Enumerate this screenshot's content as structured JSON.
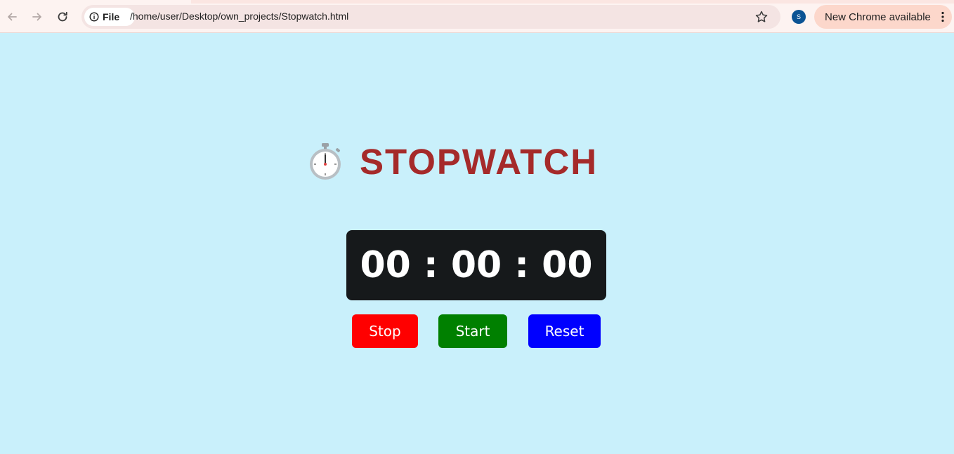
{
  "browser": {
    "address_chip_label": "File",
    "url": "/home/user/Desktop/own_projects/Stopwatch.html",
    "profile_initial": "S",
    "update_label": "New Chrome available"
  },
  "page": {
    "title": "STOPWATCH",
    "time_display": "00 : 00 : 00",
    "buttons": {
      "stop": "Stop",
      "start": "Start",
      "reset": "Reset"
    }
  },
  "colors": {
    "page_background": "#c9f0fb",
    "title": "#a52a2a",
    "display_background": "#16191b",
    "stop_button": "#ff0000",
    "start_button": "#008000",
    "reset_button": "#0000ff"
  },
  "icons": {
    "heading": "stopwatch-icon",
    "back": "arrow-left-icon",
    "forward": "arrow-right-icon",
    "reload": "reload-icon",
    "site_info": "info-icon",
    "bookmark": "star-icon",
    "menu": "kebab-menu-icon"
  }
}
